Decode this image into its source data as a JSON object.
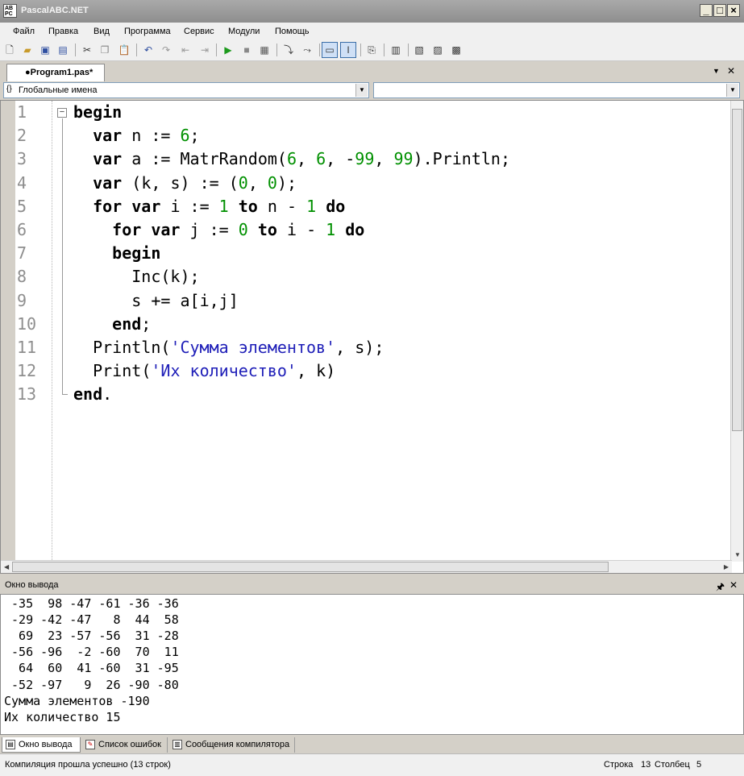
{
  "window": {
    "title": "PascalABC.NET",
    "icon_text": "AB\nPC",
    "minimize": "_",
    "maximize": "□",
    "close": "×"
  },
  "menu": [
    "Файл",
    "Правка",
    "Вид",
    "Программа",
    "Сервис",
    "Модули",
    "Помощь"
  ],
  "toolbar": {
    "icons": [
      "new-file-icon",
      "open-icon",
      "save-icon",
      "save-all-icon",
      "cut-icon",
      "copy-icon",
      "paste-icon",
      "undo-icon",
      "redo-icon",
      "navigate-back-icon",
      "navigate-forward-icon",
      "run-icon",
      "stop-icon",
      "compile-icon",
      "debug-step-into-icon",
      "debug-step-over-icon",
      "output-window-icon",
      "text-mode-icon",
      "format-icon",
      "designer-icon",
      "disasm-icon",
      "toggle-line-icon",
      "toggle-column-icon"
    ]
  },
  "document_tab": {
    "label": "●Program1.pas*",
    "dropdown": "▼",
    "close": "✕"
  },
  "scope_combo": {
    "icon": "{}",
    "value": "Глобальные имена"
  },
  "members_combo": {
    "value": ""
  },
  "editor": {
    "line_numbers": [
      "1",
      "2",
      "3",
      "4",
      "5",
      "6",
      "7",
      "8",
      "9",
      "10",
      "11",
      "12",
      "13"
    ],
    "code": [
      "begin",
      "  var n := 6;",
      "  var a := MatrRandom(6, 6, -99, 99).Println;",
      "  var (k, s) := (0, 0);",
      "  for var i := 1 to n - 1 do",
      "    for var j := 0 to i - 1 do",
      "    begin",
      "      Inc(k);",
      "      s += a[i,j]",
      "    end;",
      "  Println('Сумма элементов', s);",
      "  Print('Их количество', k)",
      "end."
    ]
  },
  "output_panel": {
    "title": "Окно вывода",
    "pin": "🖈",
    "close": "✕",
    "lines": [
      " -35  98 -47 -61 -36 -36",
      " -29 -42 -47   8  44  58",
      "  69  23 -57 -56  31 -28",
      " -56 -96  -2 -60  70  11",
      "  64  60  41 -60  31 -95",
      " -52 -97   9  26 -90 -80",
      "Сумма элементов -190",
      "Их количество 15"
    ]
  },
  "bottom_tabs": [
    "Окно вывода",
    "Список ошибок",
    "Сообщения компилятора"
  ],
  "status": {
    "message": "Компиляция прошла успешно (13 строк)",
    "row_label": "Строка",
    "row_value": "13",
    "col_label": "Столбец",
    "col_value": "5"
  }
}
